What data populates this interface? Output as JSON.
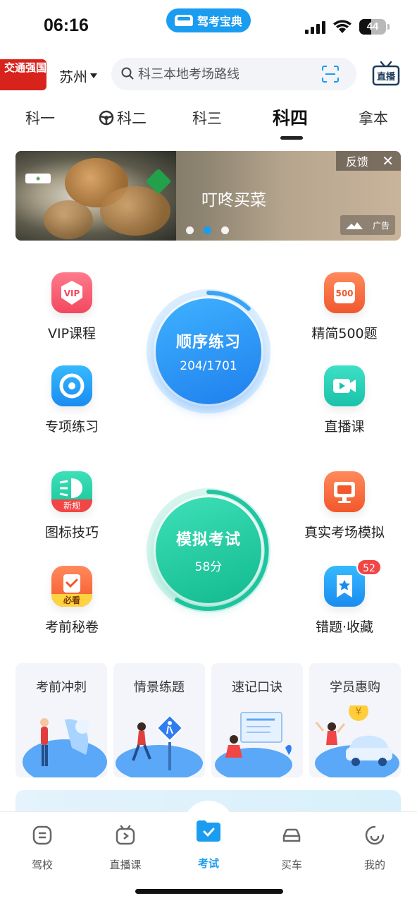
{
  "status": {
    "time": "06:16",
    "app_name": "驾考宝典",
    "battery": "44",
    "battery_level": 0.44
  },
  "header": {
    "brand": "交通强国",
    "city": "苏州",
    "search_placeholder": "科三本地考场路线",
    "live_label": "直播"
  },
  "tabs": [
    {
      "label": "科一"
    },
    {
      "label": "科二"
    },
    {
      "label": "科三"
    },
    {
      "label": "科四",
      "active": true
    },
    {
      "label": "拿本"
    }
  ],
  "banner": {
    "title": "叮咚买菜",
    "feedback": "反馈",
    "ad_label": "广告",
    "slide_count": 3,
    "active_slide": 2
  },
  "features": {
    "vip": "VIP课程",
    "jingjian": "精简500题",
    "jingjian_icon_text": "500",
    "zhuanxiang": "专项练习",
    "zhibo": "直播课",
    "tubiao": "图标技巧",
    "tubiao_badge": "新规",
    "zhenshi": "真实考场模拟",
    "kaoqian": "考前秘卷",
    "kaoqian_badge": "必看",
    "cuoti": "错题·收藏",
    "cuoti_count": "52"
  },
  "practice": {
    "title": "顺序练习",
    "progress": "204/1701",
    "done": 204,
    "total": 1701
  },
  "exam": {
    "title": "模拟考试",
    "score": "58分"
  },
  "cards": [
    {
      "title": "考前冲刺"
    },
    {
      "title": "情景练题"
    },
    {
      "title": "速记口诀"
    },
    {
      "title": "学员惠购"
    }
  ],
  "nav": [
    {
      "label": "驾校"
    },
    {
      "label": "直播课"
    },
    {
      "label": "考试",
      "active": true
    },
    {
      "label": "买车"
    },
    {
      "label": "我的"
    }
  ],
  "colors": {
    "accent": "#1a9cf0",
    "exam_green": "#22c6a2",
    "badge_red": "#f24545"
  }
}
